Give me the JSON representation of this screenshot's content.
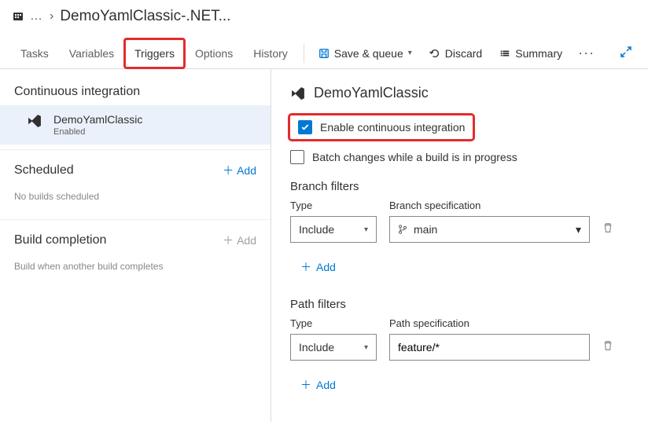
{
  "breadcrumb": {
    "ellipsis": "…",
    "title": "DemoYamlClassic-.NET..."
  },
  "tabs": {
    "tasks": "Tasks",
    "variables": "Variables",
    "triggers": "Triggers",
    "options": "Options",
    "history": "History"
  },
  "toolbar": {
    "save_queue": "Save & queue",
    "discard": "Discard",
    "summary": "Summary"
  },
  "sidebar": {
    "ci_title": "Continuous integration",
    "ci_item_label": "DemoYamlClassic",
    "ci_item_sub": "Enabled",
    "scheduled_title": "Scheduled",
    "scheduled_empty": "No builds scheduled",
    "build_completion_title": "Build completion",
    "build_completion_empty": "Build when another build completes",
    "add_label": "Add"
  },
  "content": {
    "title": "DemoYamlClassic",
    "enable_ci_label": "Enable continuous integration",
    "batch_label": "Batch changes while a build is in progress",
    "branch_filters_title": "Branch filters",
    "path_filters_title": "Path filters",
    "type_label": "Type",
    "branch_spec_label": "Branch specification",
    "path_spec_label": "Path specification",
    "add_label": "Add",
    "branch_filter": {
      "type": "Include",
      "branch": "main"
    },
    "path_filter": {
      "type": "Include",
      "path": "feature/*"
    }
  }
}
